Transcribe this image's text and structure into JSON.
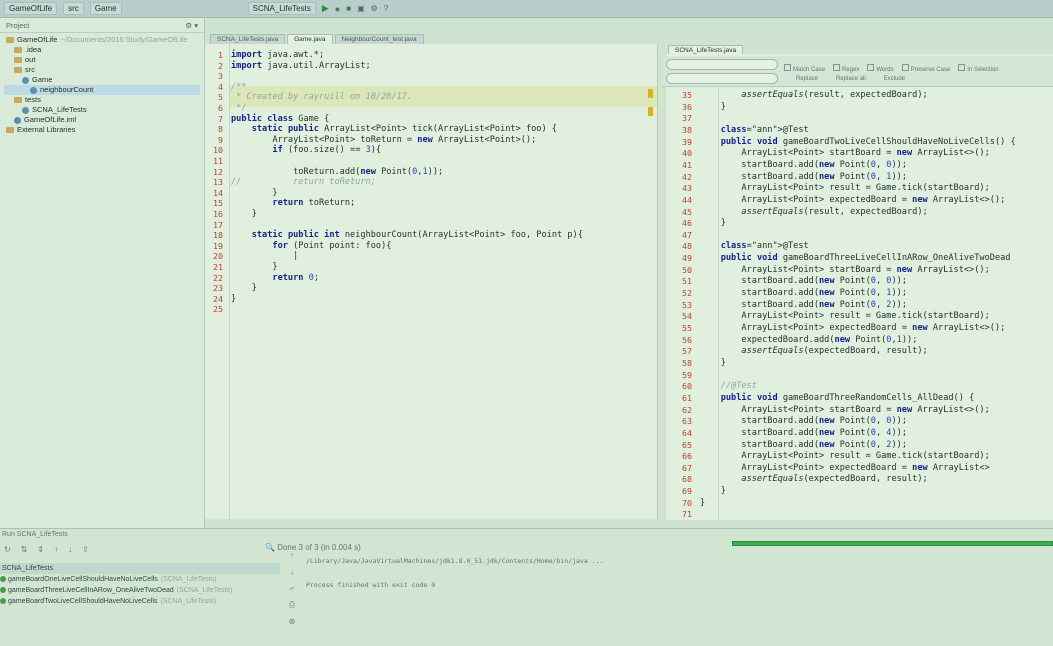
{
  "toolbar": {
    "project": "GameOfLife",
    "crumb2": "src",
    "crumb3": "Game",
    "run_config": "SCNA_LifeTests"
  },
  "sidebar": {
    "title": "Project",
    "items": [
      {
        "label": "GameOfLife",
        "extra": "~/Documents/2016 Study/GameOfLife",
        "indent": 0,
        "type": "folder"
      },
      {
        "label": ".idea",
        "indent": 1,
        "type": "folder"
      },
      {
        "label": "out",
        "indent": 1,
        "type": "folder"
      },
      {
        "label": "src",
        "indent": 1,
        "type": "folder"
      },
      {
        "label": "Game",
        "indent": 2,
        "type": "file"
      },
      {
        "label": "neighbourCount",
        "indent": 3,
        "type": "method"
      },
      {
        "label": "tests",
        "indent": 1,
        "type": "folder"
      },
      {
        "label": "SCNA_LifeTests",
        "indent": 2,
        "type": "file"
      },
      {
        "label": "GameOfLife.iml",
        "indent": 1,
        "type": "file"
      },
      {
        "label": "External Libraries",
        "indent": 0,
        "type": "folder"
      }
    ]
  },
  "editor_left": {
    "tabs": [
      "SCNA_LifeTests.java",
      "Game.java",
      "NeighbourCount_test.java"
    ],
    "lines": [
      {
        "n": "1",
        "t": "import java.awt.*;"
      },
      {
        "n": "2",
        "t": "import java.util.ArrayList;"
      },
      {
        "n": "3",
        "t": ""
      },
      {
        "n": "4",
        "t": "/**"
      },
      {
        "n": "5",
        "t": " * Created by rayruill on 10/28/17."
      },
      {
        "n": "6",
        "t": " */"
      },
      {
        "n": "7",
        "t": "public class Game {"
      },
      {
        "n": "8",
        "t": "    static public ArrayList<Point> tick(ArrayList<Point> foo) {"
      },
      {
        "n": "9",
        "t": "        ArrayList<Point> toReturn = new ArrayList<Point>();"
      },
      {
        "n": "10",
        "t": "        if (foo.size() == 3){"
      },
      {
        "n": "11",
        "t": ""
      },
      {
        "n": "12",
        "t": "            toReturn.add(new Point(0,1));"
      },
      {
        "n": "13",
        "t": "//          return toReturn;"
      },
      {
        "n": "14",
        "t": "        }"
      },
      {
        "n": "15",
        "t": "        return toReturn;"
      },
      {
        "n": "16",
        "t": "    }"
      },
      {
        "n": "17",
        "t": ""
      },
      {
        "n": "18",
        "t": "    static public int neighbourCount(ArrayList<Point> foo, Point p){"
      },
      {
        "n": "19",
        "t": "        for (Point point: foo){"
      },
      {
        "n": "20",
        "t": "            |"
      },
      {
        "n": "21",
        "t": "        }"
      },
      {
        "n": "22",
        "t": "        return 0;"
      },
      {
        "n": "23",
        "t": "    }"
      },
      {
        "n": "24",
        "t": "}"
      },
      {
        "n": "25",
        "t": ""
      }
    ]
  },
  "editor_right": {
    "tabs": [
      "SCNA_LifeTests.java"
    ],
    "search": {
      "options": [
        "Match Case",
        "Regex",
        "Words",
        "Preserve Case",
        "In Selection"
      ],
      "buttons": [
        "Replace",
        "Replace all",
        "Exclude"
      ]
    },
    "lines": [
      {
        "n": "35",
        "t": "        assertEquals(result, expectedBoard);"
      },
      {
        "n": "36",
        "t": "    }"
      },
      {
        "n": "37",
        "t": ""
      },
      {
        "n": "38",
        "t": "    @Test"
      },
      {
        "n": "39",
        "t": "    public void gameBoardTwoLiveCellShouldHaveNoLiveCells() {"
      },
      {
        "n": "40",
        "t": "        ArrayList<Point> startBoard = new ArrayList<>();"
      },
      {
        "n": "41",
        "t": "        startBoard.add(new Point(0, 0));"
      },
      {
        "n": "42",
        "t": "        startBoard.add(new Point(0, 1));"
      },
      {
        "n": "43",
        "t": "        ArrayList<Point> result = Game.tick(startBoard);"
      },
      {
        "n": "44",
        "t": "        ArrayList<Point> expectedBoard = new ArrayList<>();"
      },
      {
        "n": "45",
        "t": "        assertEquals(result, expectedBoard);"
      },
      {
        "n": "46",
        "t": "    }"
      },
      {
        "n": "47",
        "t": ""
      },
      {
        "n": "48",
        "t": "    @Test"
      },
      {
        "n": "49",
        "t": "    public void gameBoardThreeLiveCellInARow_OneAliveTwoDead"
      },
      {
        "n": "50",
        "t": "        ArrayList<Point> startBoard = new ArrayList<>();"
      },
      {
        "n": "51",
        "t": "        startBoard.add(new Point(0, 0));"
      },
      {
        "n": "52",
        "t": "        startBoard.add(new Point(0, 1));"
      },
      {
        "n": "53",
        "t": "        startBoard.add(new Point(0, 2));"
      },
      {
        "n": "54",
        "t": "        ArrayList<Point> result = Game.tick(startBoard);"
      },
      {
        "n": "55",
        "t": "        ArrayList<Point> expectedBoard = new ArrayList<>();"
      },
      {
        "n": "56",
        "t": "        expectedBoard.add(new Point(0,1));"
      },
      {
        "n": "57",
        "t": "        assertEquals(expectedBoard, result);"
      },
      {
        "n": "58",
        "t": "    }"
      },
      {
        "n": "59",
        "t": ""
      },
      {
        "n": "60",
        "t": "    //@Test"
      },
      {
        "n": "61",
        "t": "    public void gameBoardThreeRandomCells_AllDead() {"
      },
      {
        "n": "62",
        "t": "        ArrayList<Point> startBoard = new ArrayList<>();"
      },
      {
        "n": "63",
        "t": "        startBoard.add(new Point(0, 0));"
      },
      {
        "n": "64",
        "t": "        startBoard.add(new Point(0, 4));"
      },
      {
        "n": "65",
        "t": "        startBoard.add(new Point(0, 2));"
      },
      {
        "n": "66",
        "t": "        ArrayList<Point> result = Game.tick(startBoard);"
      },
      {
        "n": "67",
        "t": "        ArrayList<Point> expectedBoard = new ArrayList<>"
      },
      {
        "n": "68",
        "t": "        assertEquals(expectedBoard, result);"
      },
      {
        "n": "69",
        "t": "    }"
      },
      {
        "n": "70",
        "t": "}"
      },
      {
        "n": "71",
        "t": ""
      }
    ]
  },
  "run_panel": {
    "title": "Run SCNA_LifeTests",
    "status": "Done  3 of 3 (in 0.004 s)",
    "tests_root": "SCNA_LifeTests",
    "tests": [
      {
        "name": "gameBoardOneLiveCellShouldHaveNoLiveCells",
        "suite": "(SCNA_LifeTests)"
      },
      {
        "name": "gameBoardThreeLiveCellInARow_OneAliveTwoDead",
        "suite": "(SCNA_LifeTests)"
      },
      {
        "name": "gameBoardTwoLiveCellShouldHaveNoLiveCells",
        "suite": "(SCNA_LifeTests)"
      }
    ],
    "console": [
      "/Library/Java/JavaVirtualMachines/jdk1.8.0_51.jdk/Contents/Home/bin/java ...",
      "",
      "Process finished with exit code 0"
    ],
    "progress": 1.0
  }
}
